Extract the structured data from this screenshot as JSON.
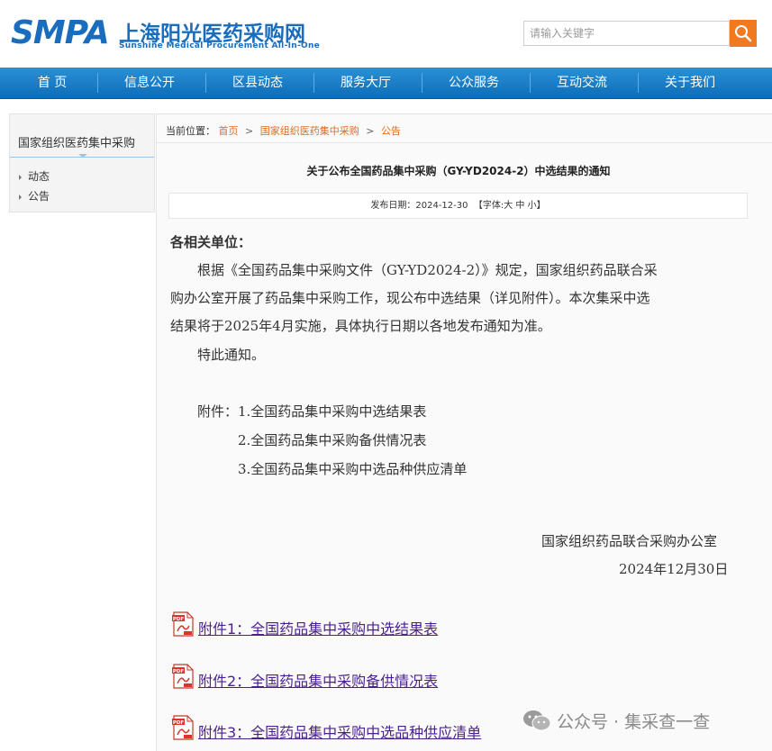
{
  "logo": {
    "abbr": "SMPA",
    "cn": "上海阳光医药采购网",
    "en": "Sunshine Medical Procurement All-In-One"
  },
  "search": {
    "placeholder": "请输入关键字"
  },
  "nav": {
    "items": [
      "首 页",
      "信息公开",
      "区县动态",
      "服务大厅",
      "公众服务",
      "互动交流",
      "关于我们"
    ]
  },
  "sidebar": {
    "title": "国家组织医药集中采购",
    "items": [
      "动态",
      "公告"
    ]
  },
  "breadcrumb": {
    "prefix": "当前位置：",
    "items": [
      "首页",
      "国家组织医药集中采购",
      "公告"
    ],
    "sep": ">"
  },
  "article": {
    "title": "关于公布全国药品集中采购（GY-YD2024-2）中选结果的通知",
    "meta_date_label": "发布日期：",
    "meta_date": "2024-12-30",
    "meta_font_label": "【字体:",
    "meta_font_big": "大",
    "meta_font_mid": "中",
    "meta_font_small": "小",
    "meta_font_close": "】",
    "greeting": "各相关单位：",
    "paragraphs": [
      "　　根据《全国药品集中采购文件（GY-YD2024-2）》规定，国家组织药品联合采",
      "购办公室开展了药品集中采购工作，现公布中选结果（详见附件）。本次集采中选",
      "结果将于2025年4月实施，具体执行日期以各地发布通知为准。",
      "　　特此通知。"
    ],
    "attachments_text": [
      "　　附件：1.全国药品集中采购中选结果表",
      "　　　　　2.全国药品集中采购备供情况表",
      "　　　　　3.全国药品集中采购中选品种供应清单"
    ],
    "signature_org": "国家组织药品联合采购办公室",
    "signature_date": "2024年12月30日",
    "attachment_links": [
      "附件1：全国药品集中采购中选结果表",
      "附件2：全国药品集中采购备供情况表",
      "附件3：全国药品集中采购中选品种供应清单"
    ]
  },
  "watermark": {
    "text": "公众号 · 集采查一查"
  },
  "colors": {
    "brand_blue": "#1a6dbd",
    "nav_blue": "#1a7fc8",
    "accent_orange": "#f07a22",
    "link_purple": "#4a1f8f"
  }
}
